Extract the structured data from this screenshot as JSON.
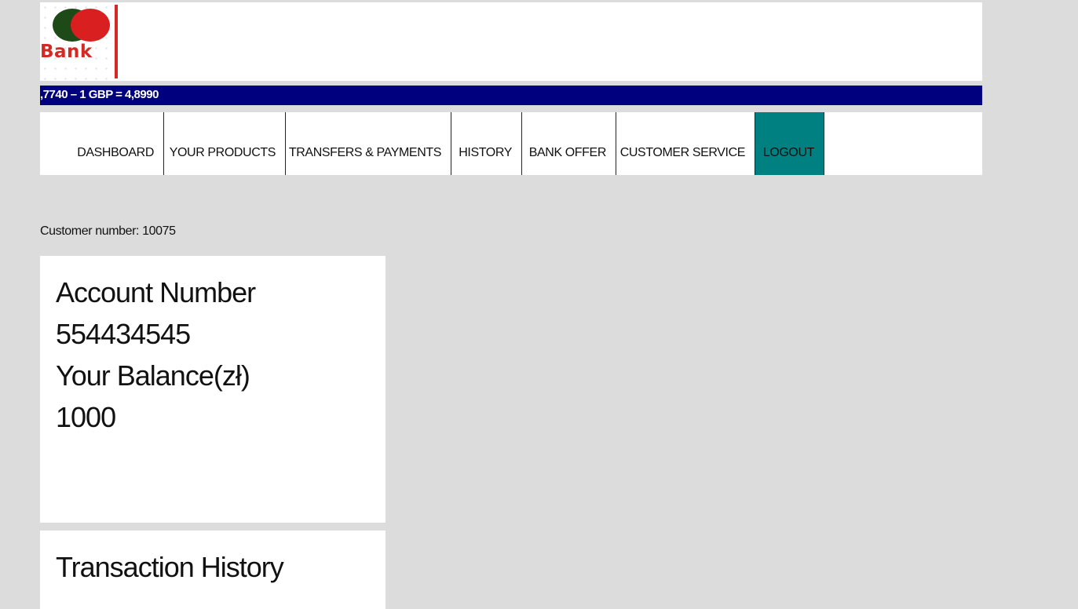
{
  "header": {
    "logo_text": "Bank",
    "colors": {
      "logo_green": "#1d4a16",
      "logo_red": "#da1f21",
      "logo_text": "#d32a24"
    }
  },
  "ticker": {
    "text": ",7740 – 1 GBP = 4,8990",
    "background": "#00007f"
  },
  "nav": {
    "items": [
      {
        "label": "DASHBOARD"
      },
      {
        "label": "YOUR PRODUCTS"
      },
      {
        "label": "TRANSFERS & PAYMENTS"
      },
      {
        "label": "HISTORY"
      },
      {
        "label": "BANK OFFER"
      },
      {
        "label": "CUSTOMER SERVICE"
      },
      {
        "label": "LOGOUT",
        "active": true
      }
    ],
    "active_color": "#008080"
  },
  "customer": {
    "text": "Customer number: 10075"
  },
  "account_card": {
    "account_label": "Account Number",
    "account_number": "554434545",
    "balance_label": "Your Balance(zł)",
    "balance_value": "1000"
  },
  "history_card": {
    "title": "Transaction History"
  }
}
